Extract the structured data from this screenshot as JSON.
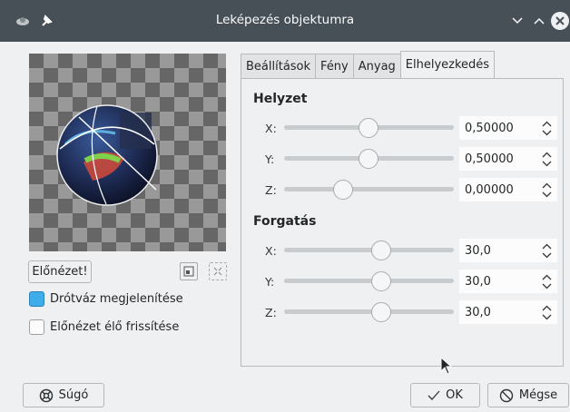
{
  "window": {
    "title": "Leképezés objektumra",
    "titlebar_color": "#475057"
  },
  "preview": {
    "button_label": "Előnézet!",
    "wireframe": {
      "label": "Drótváz megjelenítése",
      "checked": true
    },
    "live": {
      "label": "Előnézet élő frissítése",
      "checked": false
    }
  },
  "tabs": [
    {
      "label": "Beállítások",
      "active": false
    },
    {
      "label": "Fény",
      "active": false
    },
    {
      "label": "Anyag",
      "active": false
    },
    {
      "label": "Elhelyezkedés",
      "active": true
    }
  ],
  "position": {
    "title": "Helyzet",
    "rows": [
      {
        "axis": "X:",
        "value": "0,50000",
        "slider": 0.5
      },
      {
        "axis": "Y:",
        "value": "0,50000",
        "slider": 0.5
      },
      {
        "axis": "Z:",
        "value": "0,00000",
        "slider": 0.35
      }
    ]
  },
  "rotation": {
    "title": "Forgatás",
    "rows": [
      {
        "axis": "X:",
        "value": "30,0",
        "slider": 0.58
      },
      {
        "axis": "Y:",
        "value": "30,0",
        "slider": 0.58
      },
      {
        "axis": "Z:",
        "value": "30,0",
        "slider": 0.58
      }
    ]
  },
  "buttons": {
    "help": "Súgó",
    "ok": "OK",
    "cancel": "Mégse"
  },
  "colors": {
    "accent": "#3daee9",
    "background": "#eff0f1"
  }
}
